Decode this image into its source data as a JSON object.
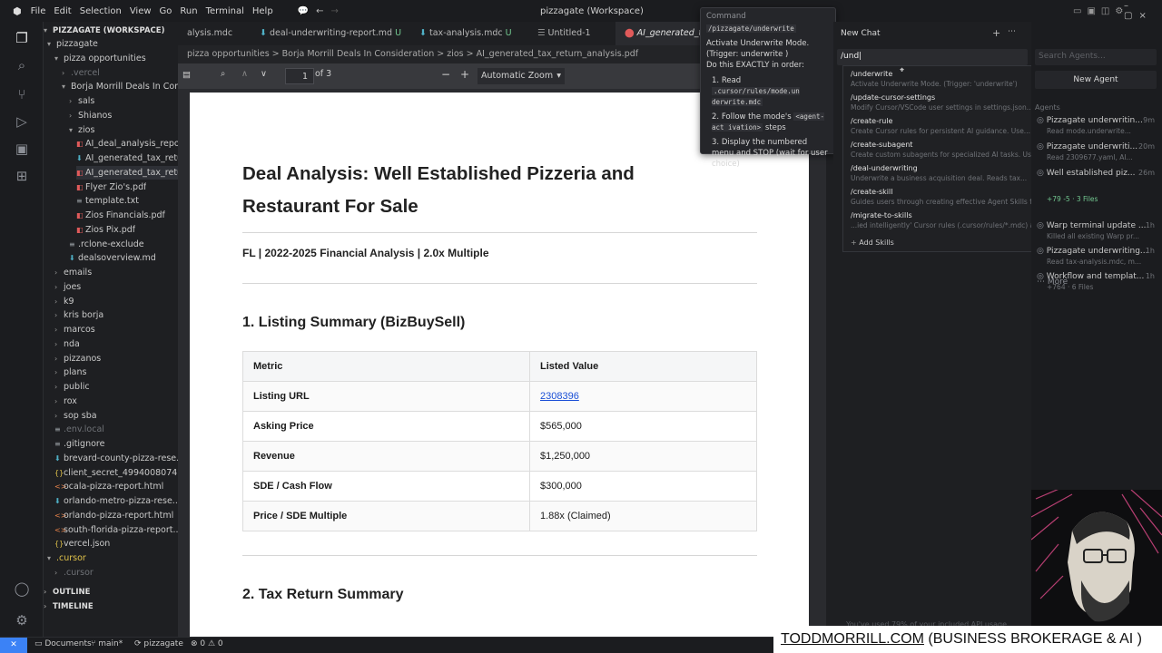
{
  "window": {
    "title": "pizzagate (Workspace)"
  },
  "menu": [
    "File",
    "Edit",
    "Selection",
    "View",
    "Go",
    "Run",
    "Terminal",
    "Help"
  ],
  "explorer": {
    "root": "PIZZAGATE (WORKSPACE)",
    "items": [
      {
        "label": "pizzagate",
        "indent": 0,
        "kind": "folder-open"
      },
      {
        "label": "pizza opportunities",
        "indent": 1,
        "kind": "folder-open"
      },
      {
        "label": ".vercel",
        "indent": 2,
        "kind": "folder"
      },
      {
        "label": "Borja Morrill Deals In Con...",
        "indent": 2,
        "kind": "folder-open"
      },
      {
        "label": "sals",
        "indent": 3,
        "kind": "folder"
      },
      {
        "label": "Shianos",
        "indent": 3,
        "kind": "folder"
      },
      {
        "label": "zios",
        "indent": 3,
        "kind": "folder-open"
      },
      {
        "label": "AI_deal_analysis_report...",
        "indent": 4,
        "kind": "pdf"
      },
      {
        "label": "AI_generated_tax_retur...",
        "indent": 4,
        "kind": "md"
      },
      {
        "label": "AI_generated_tax_retur...",
        "indent": 4,
        "kind": "pdf"
      },
      {
        "label": "Flyer Zio's.pdf",
        "indent": 4,
        "kind": "pdf"
      },
      {
        "label": "template.txt",
        "indent": 4,
        "kind": "txt"
      },
      {
        "label": "Zios Financials.pdf",
        "indent": 4,
        "kind": "pdf"
      },
      {
        "label": "Zios Pix.pdf",
        "indent": 4,
        "kind": "pdf"
      },
      {
        "label": ".rclone-exclude",
        "indent": 3,
        "kind": "txt"
      },
      {
        "label": "dealsoverview.md",
        "indent": 3,
        "kind": "md"
      },
      {
        "label": "emails",
        "indent": 1,
        "kind": "folder"
      },
      {
        "label": "joes",
        "indent": 1,
        "kind": "folder"
      },
      {
        "label": "k9",
        "indent": 1,
        "kind": "folder"
      },
      {
        "label": "kris borja",
        "indent": 1,
        "kind": "folder"
      },
      {
        "label": "marcos",
        "indent": 1,
        "kind": "folder"
      },
      {
        "label": "nda",
        "indent": 1,
        "kind": "folder"
      },
      {
        "label": "pizzanos",
        "indent": 1,
        "kind": "folder"
      },
      {
        "label": "plans",
        "indent": 1,
        "kind": "folder"
      },
      {
        "label": "public",
        "indent": 1,
        "kind": "folder"
      },
      {
        "label": "rox",
        "indent": 1,
        "kind": "folder"
      },
      {
        "label": "sop sba",
        "indent": 1,
        "kind": "folder"
      },
      {
        "label": ".env.local",
        "indent": 1,
        "kind": "txt"
      },
      {
        "label": ".gitignore",
        "indent": 1,
        "kind": "txt"
      },
      {
        "label": "brevard-county-pizza-rese...",
        "indent": 1,
        "kind": "md"
      },
      {
        "label": "client_secret_4994008074...",
        "indent": 1,
        "kind": "json"
      },
      {
        "label": "ocala-pizza-report.html",
        "indent": 1,
        "kind": "html"
      },
      {
        "label": "orlando-metro-pizza-rese...",
        "indent": 1,
        "kind": "md"
      },
      {
        "label": "orlando-pizza-report.html",
        "indent": 1,
        "kind": "html"
      },
      {
        "label": "south-florida-pizza-report....",
        "indent": 1,
        "kind": "html"
      },
      {
        "label": "vercel.json",
        "indent": 1,
        "kind": "json"
      },
      {
        "label": ".cursor",
        "indent": 0,
        "kind": "folder-open"
      },
      {
        "label": ".cursor",
        "indent": 1,
        "kind": "folder"
      }
    ],
    "outline": "OUTLINE",
    "timeline": "TIMELINE"
  },
  "tabs": [
    {
      "label": "alysis.mdc",
      "flag": ""
    },
    {
      "label": "deal-underwriting-report.md",
      "flag": "U"
    },
    {
      "label": "tax-analysis.mdc",
      "flag": "U"
    },
    {
      "label": "Untitled-1",
      "flag": ""
    },
    {
      "label": "AI_generated_tax_r",
      "flag": ""
    }
  ],
  "breadcrumb": "pizza opportunities > Borja Morrill Deals In Consideration > zios > AI_generated_tax_return_analysis.pdf",
  "pdf": {
    "page": "1",
    "of": "of 3",
    "zoom": "Automatic Zoom",
    "title": "Deal Analysis: Well Established Pizzeria and Restaurant For Sale",
    "subtitle": "FL | 2022-2025 Financial Analysis | 2.0x Multiple",
    "section1": "1. Listing Summary (BizBuySell)",
    "section2": "2. Tax Return Summary",
    "table": {
      "headers": [
        "Metric",
        "Listed Value"
      ],
      "rows": [
        [
          "Listing URL",
          "2308396"
        ],
        [
          "Asking Price",
          "$565,000"
        ],
        [
          "Revenue",
          "$1,250,000"
        ],
        [
          "SDE / Cash Flow",
          "$300,000"
        ],
        [
          "Price / SDE Multiple",
          "1.88x (Claimed)"
        ]
      ]
    }
  },
  "popup": {
    "heading": "Command",
    "command": "/pizzagate/underwrite",
    "line1": "Activate Underwrite Mode.",
    "line2": "(Trigger: underwrite )",
    "line3": "Do this EXACTLY in order:",
    "step1a": "Read",
    "step1b": ".cursor/rules/mode.un derwrite.mdc",
    "step2a": "Follow the mode's",
    "step2b": "<agent-act ivation>",
    "step2c": "steps",
    "step3": "Display the numbered menu and STOP (wait for user choice)"
  },
  "chat": {
    "title": "New Chat",
    "input": "/und",
    "commands": [
      {
        "name": "/underwrite",
        "desc": "Activate Underwrite Mode. (Trigger: 'underwrite')"
      },
      {
        "name": "/update-cursor-settings",
        "desc": "Modify Cursor/VSCode user settings in settings.json..."
      },
      {
        "name": "/create-rule",
        "desc": "Create Cursor rules for persistent AI guidance. Use..."
      },
      {
        "name": "/create-subagent",
        "desc": "Create custom subagents for specialized AI tasks. Us..."
      },
      {
        "name": "/deal-underwriting",
        "desc": "Underwrite a business acquisition deal. Reads tax..."
      },
      {
        "name": "/create-skill",
        "desc": "Guides users through creating effective Agent Skills f..."
      },
      {
        "name": "/migrate-to-skills",
        "desc": "...ied intelligently' Cursor rules (.cursor/rules/*.mdc) a..."
      }
    ],
    "add_skills": "Add Skills",
    "usage": "You've used 79% of your included API usage"
  },
  "agents": {
    "search_placeholder": "Search Agents...",
    "new_agent": "New Agent",
    "section": "Agents",
    "items": [
      {
        "title": "Pizzagate underwritin...",
        "time": "9m",
        "detail": "Read mode.underwrite..."
      },
      {
        "title": "Pizzagate underwriti...",
        "time": "20m",
        "detail": "Read 2309677.yaml, AI..."
      },
      {
        "title": "Well established piz...",
        "time": "26m",
        "detail": ""
      },
      {
        "title": "Warp terminal update ...",
        "time": "1h",
        "detail": "Killed all existing Warp pr..."
      },
      {
        "title": "Pizzagate underwriting...",
        "time": "1h",
        "detail": "Read tax-analysis.mdc, m..."
      },
      {
        "title": "Workflow and templat...",
        "time": "1h",
        "detail": "+764 · 6 Files"
      }
    ],
    "item3_extra": "+79 -5 · 3 Files",
    "more": "More"
  },
  "status": {
    "folder": "Documents",
    "branch": "main*",
    "workspace": "pizzagate",
    "problems": "⊗ 0 ⚠ 0"
  },
  "banner": {
    "site": "TODDMORRILL.COM",
    "rest": "(BUSINESS BROKERAGE  & AI )"
  },
  "colors": {
    "accent": "#3b82f6",
    "added": "#73c991",
    "pdf_icon": "#e05a5a",
    "md_icon": "#4fb0c6"
  }
}
